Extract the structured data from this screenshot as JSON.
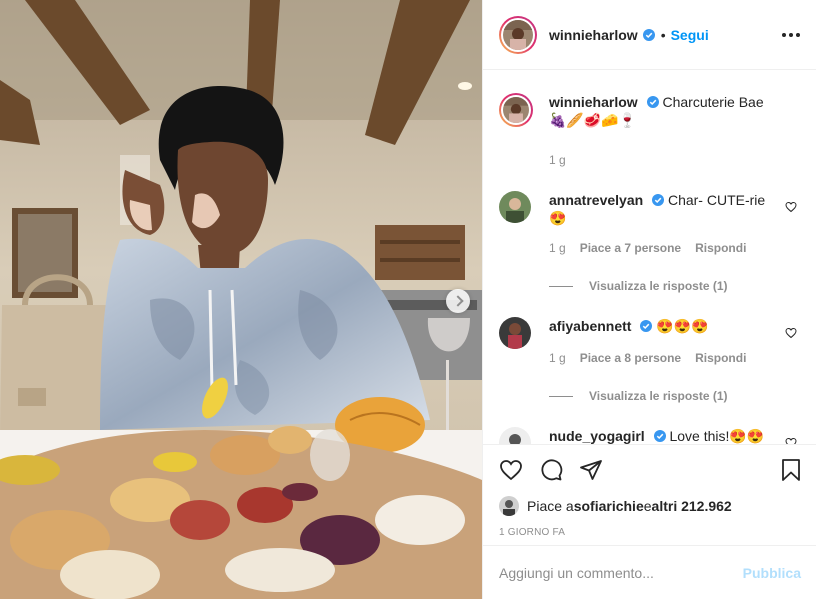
{
  "post": {
    "author": "winnieharlow",
    "follow_label": "Segui",
    "separator": "•",
    "caption_text": "Charcuterie Bae 🍇🥖🥩🧀🍷",
    "caption_time": "1 g"
  },
  "comments": [
    {
      "user": "annatrevelyan",
      "text": "Char- CUTE-rie 😍",
      "time": "1 g",
      "likes": "Piace a 7 persone",
      "reply_label": "Rispondi",
      "view_replies": "Visualizza le risposte (1)"
    },
    {
      "user": "afiyabennett",
      "text": "😍😍😍",
      "time": "1 g",
      "likes": "Piace a 8 persone",
      "reply_label": "Rispondi",
      "view_replies": "Visualizza le risposte (1)"
    },
    {
      "user": "nude_yogagirl",
      "text": "Love this!😍😍😍"
    }
  ],
  "likes": {
    "prefix": "Piace a ",
    "user": "sofiarichie",
    "middle": " e ",
    "others": "altri 212.962"
  },
  "timestamp": "1 GIORNO FA",
  "add_comment": {
    "placeholder": "Aggiungi un commento...",
    "publish_label": "Pubblica"
  },
  "icons": [
    "verified-icon",
    "more-options-icon",
    "heart-icon",
    "comment-icon",
    "share-icon",
    "bookmark-icon",
    "next-arrow-icon"
  ],
  "colors": {
    "accent": "#0095f6",
    "publish_disabled": "#b2dffc",
    "text": "#262626",
    "muted": "#8e8e8e",
    "border": "#efefef"
  }
}
